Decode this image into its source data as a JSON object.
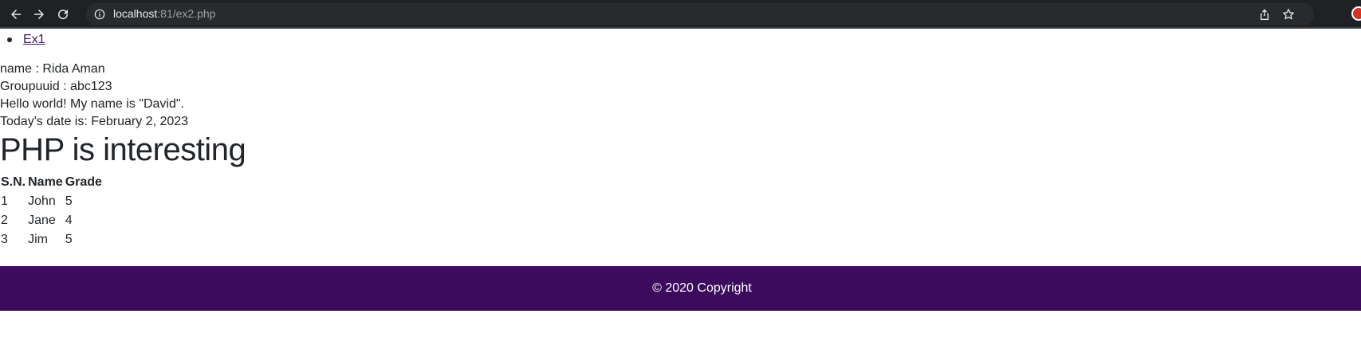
{
  "browser": {
    "url_host": "localhost",
    "url_rest": ":81/ex2.php",
    "icons": {
      "back": "arrow-left-icon",
      "forward": "arrow-right-icon",
      "reload": "reload-icon",
      "info": "info-icon",
      "share": "share-icon",
      "bookmark": "star-icon"
    }
  },
  "nav": {
    "items": [
      {
        "label": "Ex1"
      }
    ]
  },
  "info_lines": {
    "name": "name : Rida Aman",
    "group": "Groupuuid : abc123",
    "hello": "Hello world! My name is \"David\".",
    "date": "Today's date is: February 2, 2023"
  },
  "heading": "PHP is interesting",
  "table": {
    "headers": [
      "S.N.",
      "Name",
      "Grade"
    ],
    "rows": [
      [
        "1",
        "John",
        "5"
      ],
      [
        "2",
        "Jane",
        "4"
      ],
      [
        "3",
        "Jim",
        "5"
      ]
    ]
  },
  "footer": {
    "text": "© 2020 Copyright",
    "bg_color": "#3c0b5e"
  }
}
